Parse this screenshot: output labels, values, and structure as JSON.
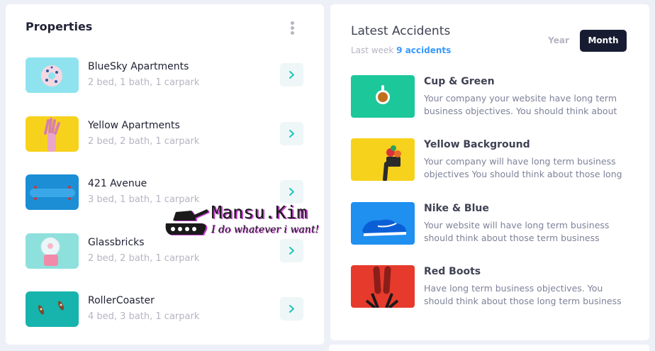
{
  "properties": {
    "title": "Properties",
    "items": [
      {
        "name": "BlueSky Apartments",
        "meta": "2 bed, 1 bath, 1 carpark"
      },
      {
        "name": "Yellow Apartments",
        "meta": "2 bed, 2 bath, 1 carpark"
      },
      {
        "name": "421 Avenue",
        "meta": "3 bed, 1 bath, 1 carpark"
      },
      {
        "name": "Glassbricks",
        "meta": "2 bed, 2 bath, 1 carpark"
      },
      {
        "name": "RollerCoaster",
        "meta": "4 bed, 3 bath, 1 carpark"
      }
    ]
  },
  "accidents": {
    "title": "Latest Accidents",
    "subtitle_prefix": "Last week",
    "subtitle_highlight": "9 accidents",
    "tab_year": "Year",
    "tab_month": "Month",
    "items": [
      {
        "name": "Cup & Green",
        "desc": "Your company your website have long term business objectives. You should think about"
      },
      {
        "name": "Yellow Background",
        "desc": "Your company will have long term business objectives You should think about those long"
      },
      {
        "name": "Nike & Blue",
        "desc": "Your website will have long term business should think about those term business"
      },
      {
        "name": "Red Boots",
        "desc": "Have long term business objectives. You should think about those long term business"
      }
    ]
  },
  "watermark": {
    "title": "Mansu.Kim",
    "subtitle": "I do whatever i want!"
  },
  "colors": {
    "accent_blue": "#3699ff",
    "dark_button": "#181c32",
    "teal_arrow": "#1bc5bd"
  }
}
